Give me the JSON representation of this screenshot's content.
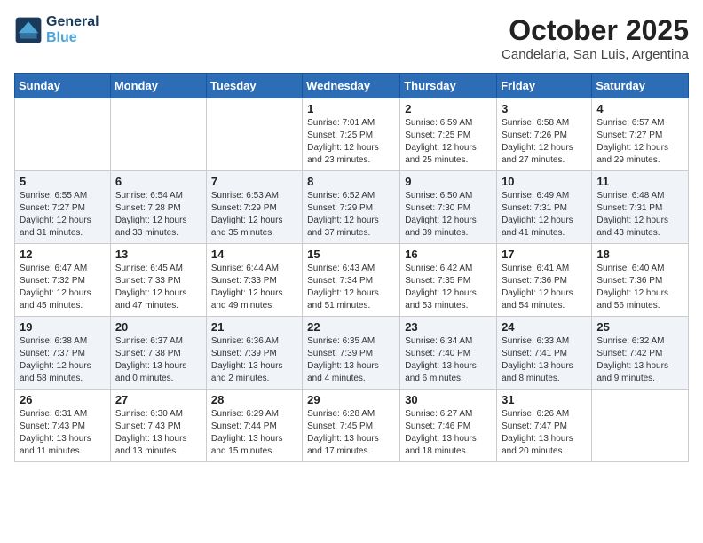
{
  "header": {
    "logo_line1": "General",
    "logo_line2": "Blue",
    "month": "October 2025",
    "location": "Candelaria, San Luis, Argentina"
  },
  "weekdays": [
    "Sunday",
    "Monday",
    "Tuesday",
    "Wednesday",
    "Thursday",
    "Friday",
    "Saturday"
  ],
  "weeks": [
    [
      {
        "day": "",
        "info": ""
      },
      {
        "day": "",
        "info": ""
      },
      {
        "day": "",
        "info": ""
      },
      {
        "day": "1",
        "info": "Sunrise: 7:01 AM\nSunset: 7:25 PM\nDaylight: 12 hours\nand 23 minutes."
      },
      {
        "day": "2",
        "info": "Sunrise: 6:59 AM\nSunset: 7:25 PM\nDaylight: 12 hours\nand 25 minutes."
      },
      {
        "day": "3",
        "info": "Sunrise: 6:58 AM\nSunset: 7:26 PM\nDaylight: 12 hours\nand 27 minutes."
      },
      {
        "day": "4",
        "info": "Sunrise: 6:57 AM\nSunset: 7:27 PM\nDaylight: 12 hours\nand 29 minutes."
      }
    ],
    [
      {
        "day": "5",
        "info": "Sunrise: 6:55 AM\nSunset: 7:27 PM\nDaylight: 12 hours\nand 31 minutes."
      },
      {
        "day": "6",
        "info": "Sunrise: 6:54 AM\nSunset: 7:28 PM\nDaylight: 12 hours\nand 33 minutes."
      },
      {
        "day": "7",
        "info": "Sunrise: 6:53 AM\nSunset: 7:29 PM\nDaylight: 12 hours\nand 35 minutes."
      },
      {
        "day": "8",
        "info": "Sunrise: 6:52 AM\nSunset: 7:29 PM\nDaylight: 12 hours\nand 37 minutes."
      },
      {
        "day": "9",
        "info": "Sunrise: 6:50 AM\nSunset: 7:30 PM\nDaylight: 12 hours\nand 39 minutes."
      },
      {
        "day": "10",
        "info": "Sunrise: 6:49 AM\nSunset: 7:31 PM\nDaylight: 12 hours\nand 41 minutes."
      },
      {
        "day": "11",
        "info": "Sunrise: 6:48 AM\nSunset: 7:31 PM\nDaylight: 12 hours\nand 43 minutes."
      }
    ],
    [
      {
        "day": "12",
        "info": "Sunrise: 6:47 AM\nSunset: 7:32 PM\nDaylight: 12 hours\nand 45 minutes."
      },
      {
        "day": "13",
        "info": "Sunrise: 6:45 AM\nSunset: 7:33 PM\nDaylight: 12 hours\nand 47 minutes."
      },
      {
        "day": "14",
        "info": "Sunrise: 6:44 AM\nSunset: 7:33 PM\nDaylight: 12 hours\nand 49 minutes."
      },
      {
        "day": "15",
        "info": "Sunrise: 6:43 AM\nSunset: 7:34 PM\nDaylight: 12 hours\nand 51 minutes."
      },
      {
        "day": "16",
        "info": "Sunrise: 6:42 AM\nSunset: 7:35 PM\nDaylight: 12 hours\nand 53 minutes."
      },
      {
        "day": "17",
        "info": "Sunrise: 6:41 AM\nSunset: 7:36 PM\nDaylight: 12 hours\nand 54 minutes."
      },
      {
        "day": "18",
        "info": "Sunrise: 6:40 AM\nSunset: 7:36 PM\nDaylight: 12 hours\nand 56 minutes."
      }
    ],
    [
      {
        "day": "19",
        "info": "Sunrise: 6:38 AM\nSunset: 7:37 PM\nDaylight: 12 hours\nand 58 minutes."
      },
      {
        "day": "20",
        "info": "Sunrise: 6:37 AM\nSunset: 7:38 PM\nDaylight: 13 hours\nand 0 minutes."
      },
      {
        "day": "21",
        "info": "Sunrise: 6:36 AM\nSunset: 7:39 PM\nDaylight: 13 hours\nand 2 minutes."
      },
      {
        "day": "22",
        "info": "Sunrise: 6:35 AM\nSunset: 7:39 PM\nDaylight: 13 hours\nand 4 minutes."
      },
      {
        "day": "23",
        "info": "Sunrise: 6:34 AM\nSunset: 7:40 PM\nDaylight: 13 hours\nand 6 minutes."
      },
      {
        "day": "24",
        "info": "Sunrise: 6:33 AM\nSunset: 7:41 PM\nDaylight: 13 hours\nand 8 minutes."
      },
      {
        "day": "25",
        "info": "Sunrise: 6:32 AM\nSunset: 7:42 PM\nDaylight: 13 hours\nand 9 minutes."
      }
    ],
    [
      {
        "day": "26",
        "info": "Sunrise: 6:31 AM\nSunset: 7:43 PM\nDaylight: 13 hours\nand 11 minutes."
      },
      {
        "day": "27",
        "info": "Sunrise: 6:30 AM\nSunset: 7:43 PM\nDaylight: 13 hours\nand 13 minutes."
      },
      {
        "day": "28",
        "info": "Sunrise: 6:29 AM\nSunset: 7:44 PM\nDaylight: 13 hours\nand 15 minutes."
      },
      {
        "day": "29",
        "info": "Sunrise: 6:28 AM\nSunset: 7:45 PM\nDaylight: 13 hours\nand 17 minutes."
      },
      {
        "day": "30",
        "info": "Sunrise: 6:27 AM\nSunset: 7:46 PM\nDaylight: 13 hours\nand 18 minutes."
      },
      {
        "day": "31",
        "info": "Sunrise: 6:26 AM\nSunset: 7:47 PM\nDaylight: 13 hours\nand 20 minutes."
      },
      {
        "day": "",
        "info": ""
      }
    ]
  ]
}
